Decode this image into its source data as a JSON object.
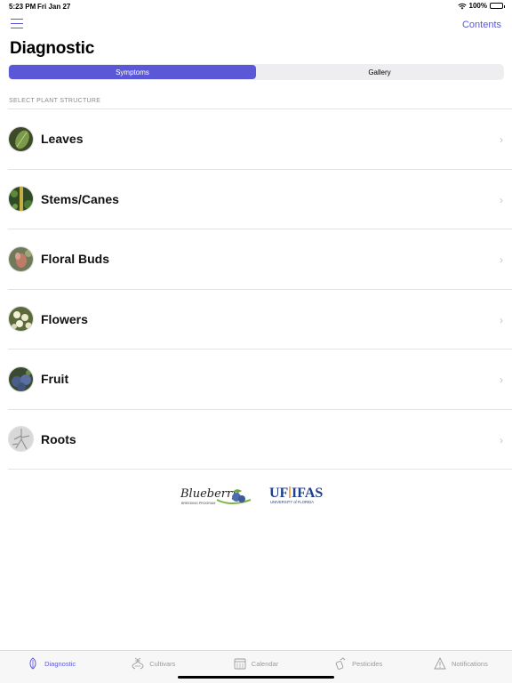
{
  "status": {
    "time": "5:23 PM",
    "date": "Fri Jan 27",
    "battery": "100%"
  },
  "nav": {
    "contents_label": "Contents"
  },
  "page": {
    "title": "Diagnostic"
  },
  "segments": [
    {
      "label": "Symptoms",
      "active": true
    },
    {
      "label": "Gallery",
      "active": false
    }
  ],
  "section_header": "SELECT PLANT STRUCTURE",
  "structures": [
    {
      "label": "Leaves"
    },
    {
      "label": "Stems/Canes"
    },
    {
      "label": "Floral Buds"
    },
    {
      "label": "Flowers"
    },
    {
      "label": "Fruit"
    },
    {
      "label": "Roots"
    }
  ],
  "logos": {
    "blueberry_text": "Blueberry",
    "blueberry_sub": "BREEDING PROGRAM",
    "uf_text": "UF",
    "ifas_text": "IFAS",
    "uf_sub": "UNIVERSITY of FLORIDA"
  },
  "tabs": [
    {
      "label": "Diagnostic",
      "icon": "leaf-icon",
      "active": true
    },
    {
      "label": "Cultivars",
      "icon": "dna-icon",
      "active": false
    },
    {
      "label": "Calendar",
      "icon": "calendar-icon",
      "active": false
    },
    {
      "label": "Pesticides",
      "icon": "spray-icon",
      "active": false
    },
    {
      "label": "Notifications",
      "icon": "warning-icon",
      "active": false
    }
  ],
  "colors": {
    "accent": "#5b58d8",
    "tab_inactive": "#9a9a9e"
  }
}
